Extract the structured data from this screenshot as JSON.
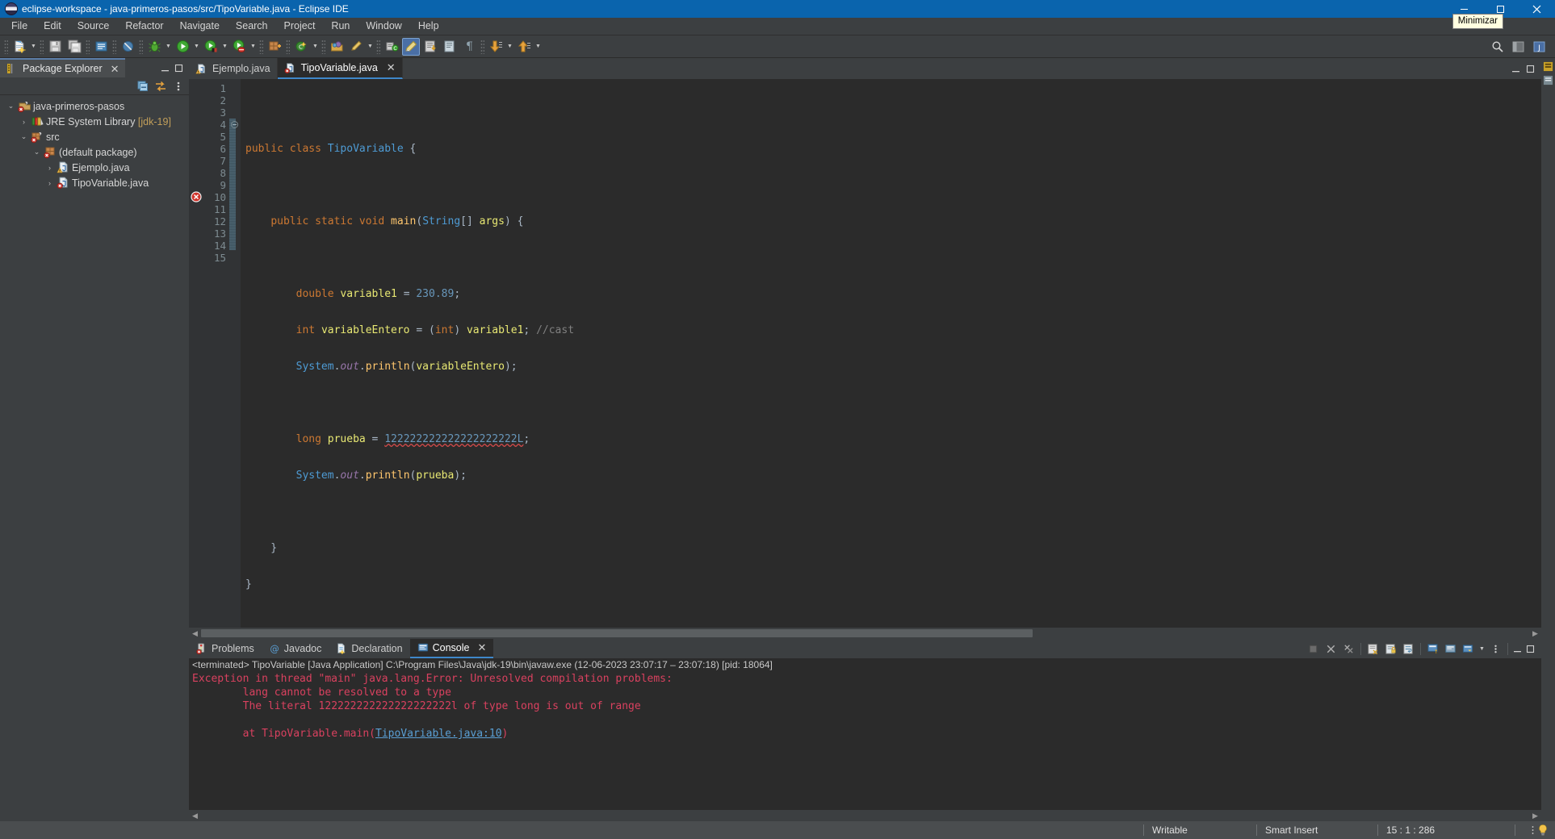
{
  "window": {
    "title": "eclipse-workspace - java-primeros-pasos/src/TipoVariable.java - Eclipse IDE",
    "app_icon": "eclipse-icon",
    "minimize_label": "—",
    "maximize_label": "❐",
    "close_label": "✕",
    "tooltip": "Minimizar"
  },
  "menubar": {
    "items": [
      {
        "label": "File"
      },
      {
        "label": "Edit"
      },
      {
        "label": "Source"
      },
      {
        "label": "Refactor"
      },
      {
        "label": "Navigate"
      },
      {
        "label": "Search"
      },
      {
        "label": "Project"
      },
      {
        "label": "Run"
      },
      {
        "label": "Window"
      },
      {
        "label": "Help"
      }
    ]
  },
  "toolbar": {
    "buttons": [
      {
        "name": "new-wizard",
        "icon": "new-file-icon",
        "dropdown": true
      },
      {
        "name": "save",
        "icon": "save-icon",
        "dropdown": false
      },
      {
        "name": "save-all",
        "icon": "save-all-icon",
        "dropdown": false
      },
      {
        "name": "new-java-class",
        "icon": "document-icon",
        "dropdown": false
      },
      {
        "name": "toggle-breakpoints",
        "icon": "skip-breakpoints-icon",
        "dropdown": false
      },
      {
        "name": "debug",
        "icon": "debug-bug-icon",
        "dropdown": true
      },
      {
        "name": "run",
        "icon": "run-green-play-icon",
        "dropdown": true
      },
      {
        "name": "run-coverage",
        "icon": "coverage-icon",
        "dropdown": true
      },
      {
        "name": "run-external-tools",
        "icon": "external-tools-icon",
        "dropdown": true
      },
      {
        "name": "new-java-project",
        "icon": "package-plus-icon",
        "dropdown": false
      },
      {
        "name": "new-java-type",
        "icon": "class-new-icon",
        "dropdown": true
      },
      {
        "name": "open-type",
        "icon": "open-type-icon",
        "dropdown": false
      },
      {
        "name": "search",
        "icon": "pencil-search-icon",
        "dropdown": true
      },
      {
        "name": "link-editor",
        "icon": "link-icon",
        "dropdown": false
      },
      {
        "name": "toggle-mark-occurrences",
        "icon": "highlighter-icon",
        "dropdown": false
      },
      {
        "name": "next-annotation",
        "icon": "next-annotation-icon",
        "dropdown": false
      },
      {
        "name": "previous-annotation",
        "icon": "prev-annotation-icon",
        "dropdown": false
      },
      {
        "name": "pilcrow",
        "icon": "pilcrow-icon",
        "dropdown": false
      },
      {
        "name": "back-navigation",
        "icon": "arrow-down-yellow-icon",
        "dropdown": true
      },
      {
        "name": "forward-navigation",
        "icon": "arrow-up-yellow-icon",
        "dropdown": true
      }
    ],
    "right_buttons": [
      {
        "name": "quick-access-search",
        "icon": "search-icon"
      },
      {
        "name": "open-perspective",
        "icon": "perspective-icon"
      },
      {
        "name": "java-perspective",
        "icon": "java-perspective-icon"
      }
    ]
  },
  "package_explorer": {
    "tab_label": "Package Explorer",
    "tab_icon": "package-explorer-icon",
    "close_icon": "close-icon",
    "minimize_icon": "minimize-icon",
    "maximize_icon": "maximize-icon",
    "toolbar": [
      {
        "name": "collapse-all",
        "icon": "collapse-all-icon"
      },
      {
        "name": "link-with-editor",
        "icon": "link-with-editor-icon"
      },
      {
        "name": "view-menu",
        "icon": "view-menu-icon"
      }
    ],
    "tree": [
      {
        "label": "java-primeros-pasos",
        "icon": "java-project-error-icon",
        "twisty": "⌄",
        "indent": 0,
        "error": true
      },
      {
        "label": "JRE System Library",
        "suffix": " [jdk-19]",
        "icon": "library-icon",
        "twisty": "›",
        "indent": 1,
        "error": false
      },
      {
        "label": "src",
        "icon": "source-folder-error-icon",
        "twisty": "⌄",
        "indent": 1,
        "error": true
      },
      {
        "label": "(default package)",
        "icon": "package-error-icon",
        "twisty": "⌄",
        "indent": 2,
        "error": true
      },
      {
        "label": "Ejemplo.java",
        "icon": "java-file-warning-icon",
        "twisty": "›",
        "indent": 3,
        "error": false
      },
      {
        "label": "TipoVariable.java",
        "icon": "java-file-error-icon",
        "twisty": "›",
        "indent": 3,
        "error": true
      }
    ]
  },
  "editor": {
    "tabs": [
      {
        "label": "Ejemplo.java",
        "icon": "java-file-warning-icon",
        "active": false,
        "closable": false
      },
      {
        "label": "TipoVariable.java",
        "icon": "java-file-error-icon",
        "active": true,
        "closable": true
      }
    ],
    "tab_right_buttons": [
      {
        "name": "minimize-editor",
        "icon": "minimize-icon"
      },
      {
        "name": "maximize-editor",
        "icon": "maximize-icon"
      }
    ],
    "line_numbers": [
      "1",
      "2",
      "3",
      "4",
      "5",
      "6",
      "7",
      "8",
      "9",
      "10",
      "11",
      "12",
      "13",
      "14",
      "15"
    ],
    "error_line": 10,
    "fold_line": 4,
    "lines": [
      {
        "n": 1,
        "text": ""
      },
      {
        "n": 2,
        "text": "public class TipoVariable {"
      },
      {
        "n": 3,
        "text": ""
      },
      {
        "n": 4,
        "text": "    public static void main(String[] args) {"
      },
      {
        "n": 5,
        "text": ""
      },
      {
        "n": 6,
        "text": "        double variable1 = 230.89;"
      },
      {
        "n": 7,
        "text": "        int variableEntero = (int) variable1; //cast"
      },
      {
        "n": 8,
        "text": "        System.out.println(variableEntero);"
      },
      {
        "n": 9,
        "text": ""
      },
      {
        "n": 10,
        "text": "        long prueba = 122222222222222222222L;"
      },
      {
        "n": 11,
        "text": "        System.out.println(prueba);"
      },
      {
        "n": 12,
        "text": ""
      },
      {
        "n": 13,
        "text": "    }"
      },
      {
        "n": 14,
        "text": "}"
      },
      {
        "n": 15,
        "text": ""
      }
    ],
    "tokens": {
      "kw_public": "public",
      "kw_class": "class",
      "kw_static": "static",
      "kw_void": "void",
      "kw_double": "double",
      "kw_int": "int",
      "kw_long": "long",
      "cls_TipoVariable": "TipoVariable",
      "fn_main": "main",
      "typ_String": "String",
      "var_args": "args",
      "var_variable1": "variable1",
      "var_variableEntero": "variableEntero",
      "var_prueba": "prueba",
      "num_230_89": "230.89",
      "num_long_literal": "122222222222222222222L",
      "cls_System": "System",
      "fld_out": "out",
      "mth_println": "println",
      "comment_cast": "//cast"
    }
  },
  "console": {
    "tabs": [
      {
        "label": "Problems",
        "icon": "problems-error-icon",
        "active": false
      },
      {
        "label": "Javadoc",
        "icon": "javadoc-at-icon",
        "active": false
      },
      {
        "label": "Declaration",
        "icon": "declaration-icon",
        "active": false
      },
      {
        "label": "Console",
        "icon": "console-icon",
        "active": true,
        "closable": true
      }
    ],
    "toolbar": [
      {
        "name": "terminate",
        "icon": "terminate-stop-icon"
      },
      {
        "name": "remove-launch",
        "icon": "remove-x-icon"
      },
      {
        "name": "remove-all-terminated",
        "icon": "remove-all-icon"
      },
      {
        "name": "clear-console",
        "icon": "clear-console-icon"
      },
      {
        "name": "scroll-lock",
        "icon": "scroll-lock-icon"
      },
      {
        "name": "word-wrap",
        "icon": "word-wrap-icon"
      },
      {
        "name": "pin-console",
        "icon": "pin-console-icon"
      },
      {
        "name": "display-selected-console",
        "icon": "display-console-icon"
      },
      {
        "name": "open-console",
        "icon": "open-console-icon"
      },
      {
        "name": "console-view-menu",
        "icon": "view-menu-icon"
      }
    ],
    "right_buttons": [
      {
        "name": "minimize-console",
        "icon": "minimize-icon"
      },
      {
        "name": "maximize-console",
        "icon": "maximize-icon"
      }
    ],
    "header": "<terminated> TipoVariable [Java Application] C:\\Program Files\\Java\\jdk-19\\bin\\javaw.exe  (12-06-2023 23:07:17 – 23:07:18) [pid: 18064]",
    "output": [
      {
        "text": "Exception in thread \"main\" java.lang.Error: Unresolved compilation problems: ",
        "link": null
      },
      {
        "text": "\tlang cannot be resolved to a type",
        "link": null
      },
      {
        "text": "\tThe literal 122222222222222222222l of type long is out of range",
        "link": null
      },
      {
        "text": "",
        "link": null
      },
      {
        "text": "\tat TipoVariable.main(",
        "link": "TipoVariable.java:10",
        "suffix": ")"
      }
    ]
  },
  "statusbar": {
    "writable": "Writable",
    "insert_mode": "Smart Insert",
    "position": "15 : 1 : 286",
    "tip_icon": "lightbulb-icon",
    "menu_dots": "vertical-dots-icon"
  },
  "colors": {
    "title_bar": "#0a64ad",
    "chrome": "#3c3f41",
    "editor_bg": "#2b2b2b",
    "accent_tab": "#3f87c9",
    "error_red": "#d9415f",
    "keyword": "#cc7832",
    "string": "#6a8759",
    "number": "#6897bb",
    "method": "#ffc66d",
    "field": "#9876aa",
    "status_bar": "#4a4d4f"
  }
}
